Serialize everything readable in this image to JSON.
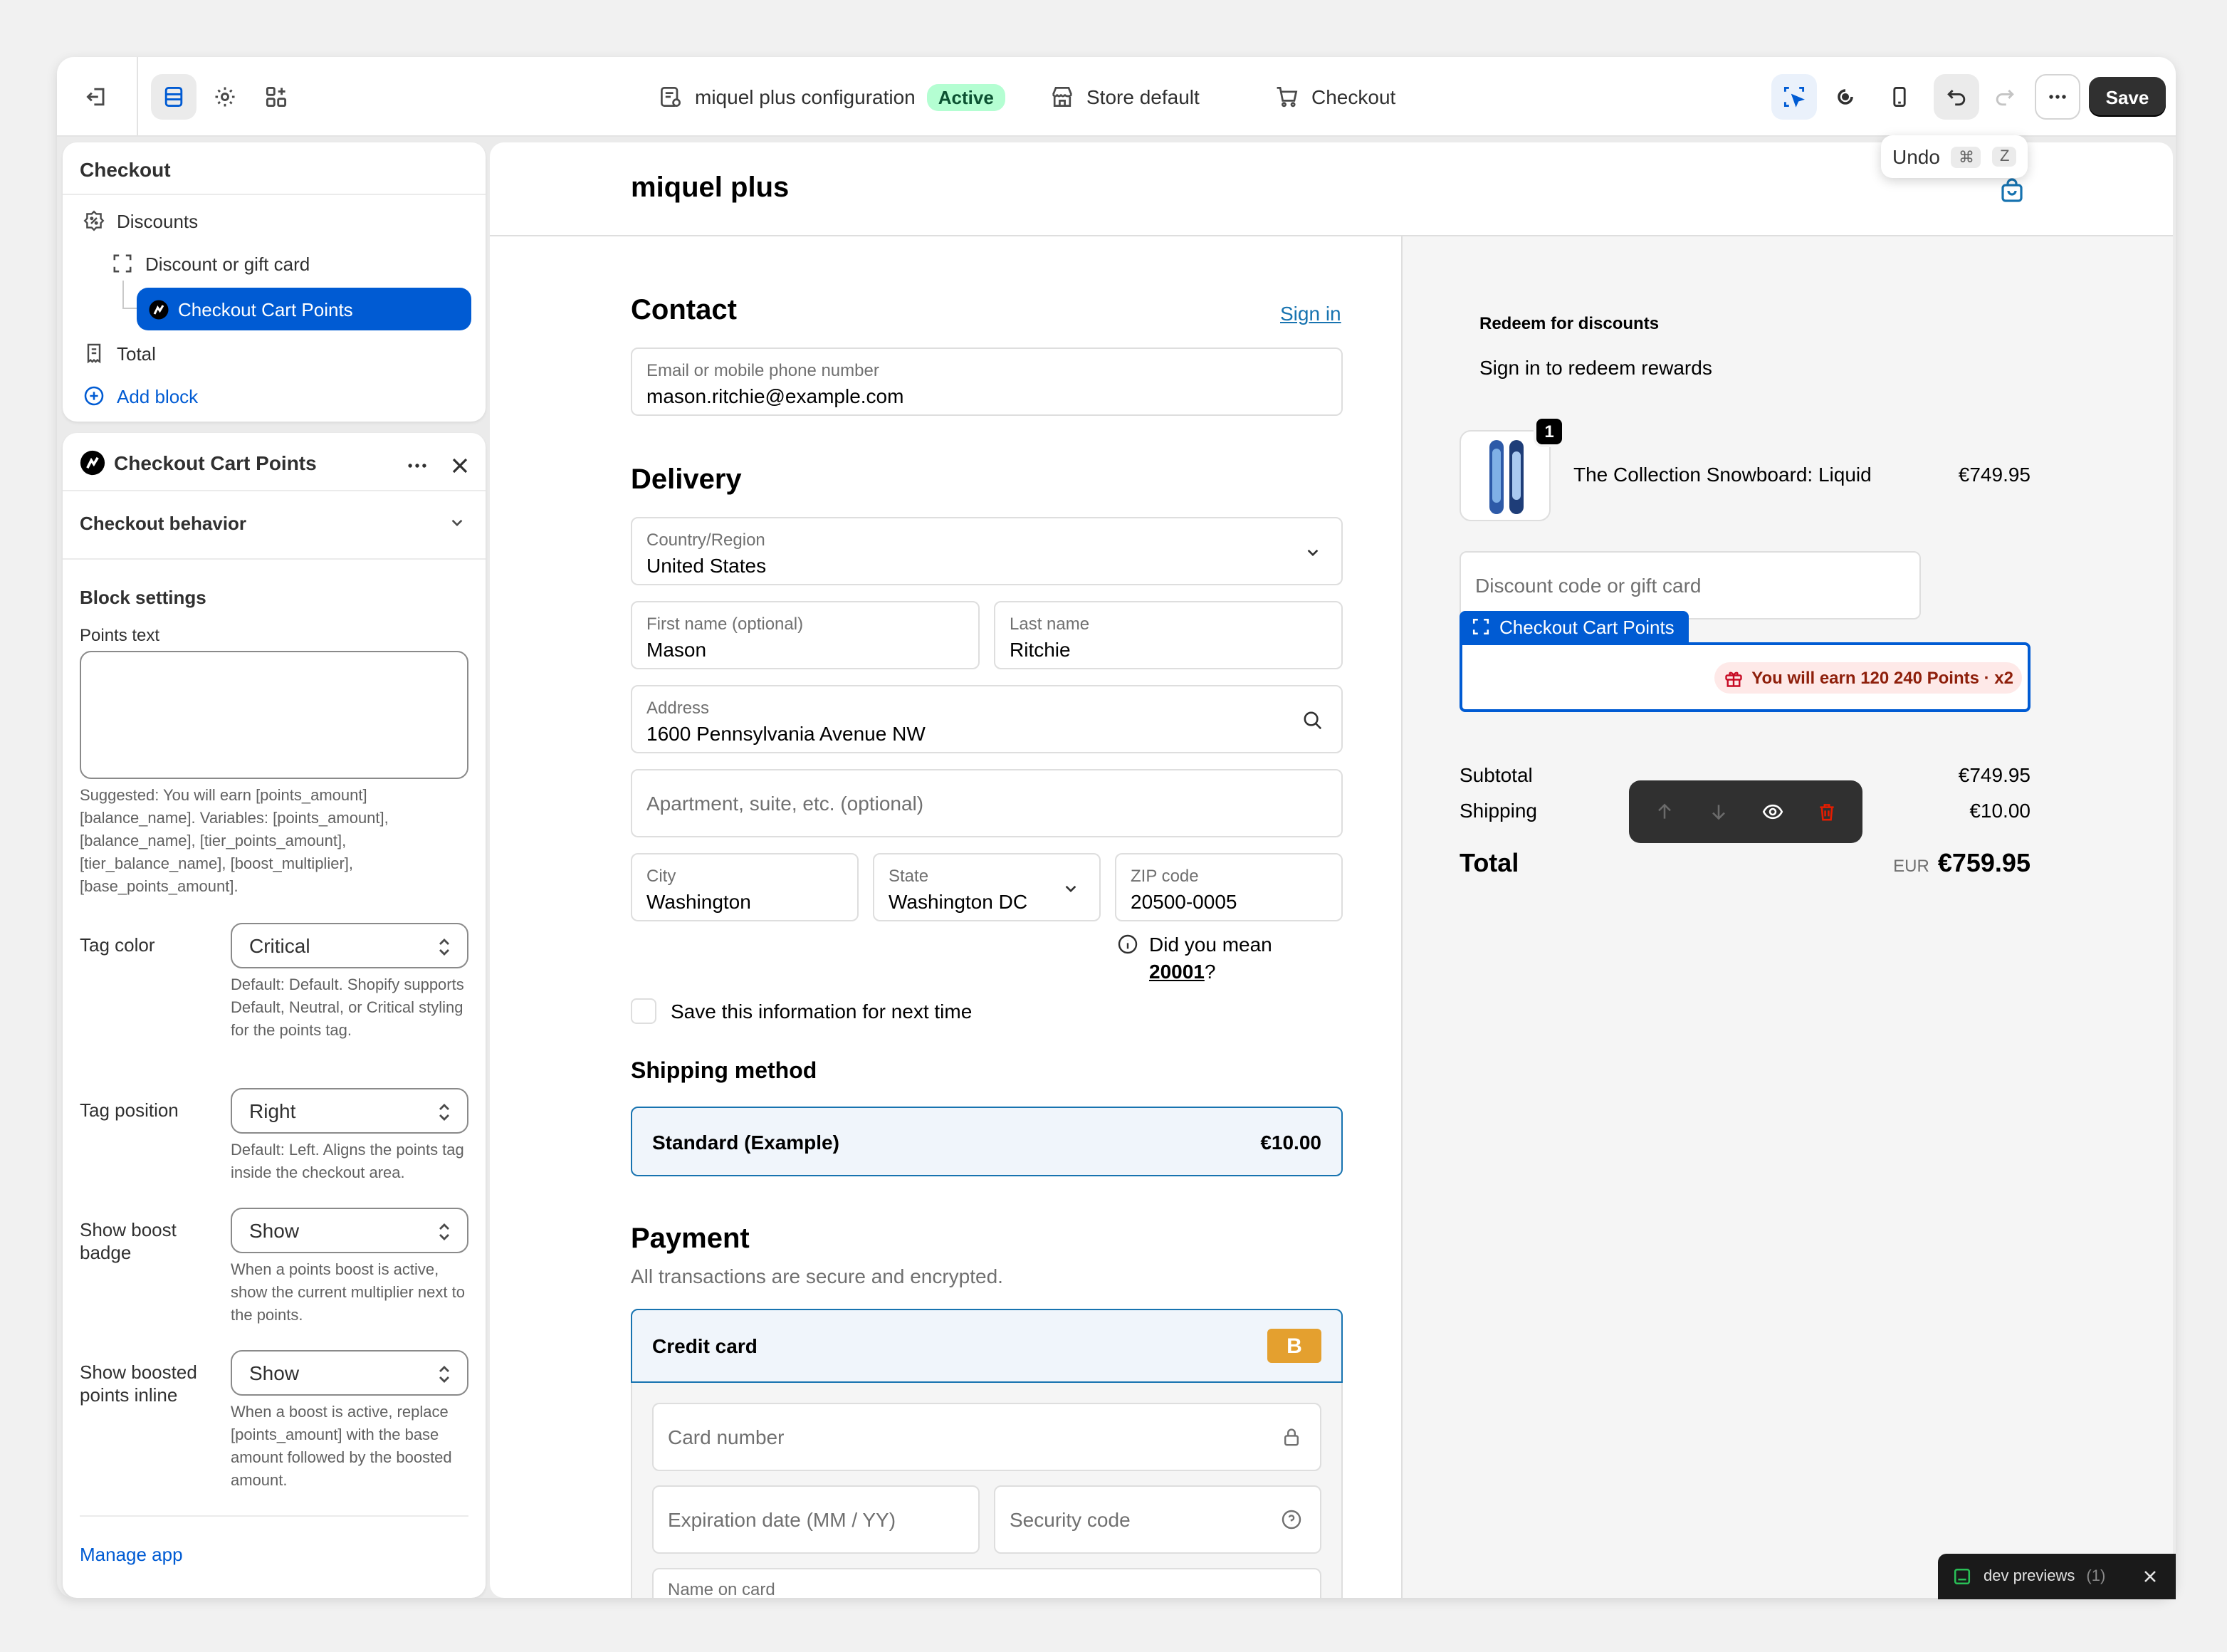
{
  "topbar": {
    "config_name": "miquel plus configuration",
    "status_badge": "Active",
    "store": "Store default",
    "page": "Checkout",
    "save_label": "Save",
    "undo_tooltip": {
      "label": "Undo",
      "key1": "⌘",
      "key2": "Z"
    }
  },
  "sidebar": {
    "section_title": "Checkout",
    "items": [
      {
        "label": "Discounts",
        "icon": "discount-gear-icon"
      },
      {
        "label": "Discount or gift card",
        "icon": "dashed-frame-icon"
      },
      {
        "label": "Checkout Cart Points",
        "icon": "app-logo-icon",
        "selected": true
      },
      {
        "label": "Total",
        "icon": "receipt-icon"
      }
    ],
    "add_block": "Add block"
  },
  "block_panel": {
    "title": "Checkout Cart Points",
    "accordion": "Checkout behavior",
    "settings_heading": "Block settings",
    "points_text_label": "Points text",
    "points_text_value": "",
    "points_text_help": "Suggested: You will earn [points_amount] [balance_name]. Variables: [points_amount], [balance_name], [tier_points_amount], [tier_balance_name], [boost_multiplier], [base_points_amount].",
    "fields": [
      {
        "label": "Tag color",
        "value": "Critical",
        "help": "Default: Default. Shopify supports Default, Neutral, or Critical styling for the points tag."
      },
      {
        "label": "Tag position",
        "value": "Right",
        "help": "Default: Left. Aligns the points tag inside the checkout area."
      },
      {
        "label": "Show boost badge",
        "value": "Show",
        "help": "When a points boost is active, show the current multiplier next to the points."
      },
      {
        "label": "Show boosted points inline",
        "value": "Show",
        "help": "When a boost is active, replace [points_amount] with the base amount followed by the boosted amount."
      }
    ],
    "manage_app": "Manage app"
  },
  "checkout": {
    "shop_name": "miquel plus",
    "contact_heading": "Contact",
    "sign_in": "Sign in",
    "email_label": "Email or mobile phone number",
    "email_value": "mason.ritchie@example.com",
    "delivery_heading": "Delivery",
    "country_label": "Country/Region",
    "country_value": "United States",
    "first_name_label": "First name (optional)",
    "first_name_value": "Mason",
    "last_name_label": "Last name",
    "last_name_value": "Ritchie",
    "address_label": "Address",
    "address_value": "1600 Pennsylvania Avenue NW",
    "apartment_placeholder": "Apartment, suite, etc. (optional)",
    "city_label": "City",
    "city_value": "Washington",
    "state_label": "State",
    "state_value": "Washington DC",
    "zip_label": "ZIP code",
    "zip_value": "20500-0005",
    "zip_suggestion_prefix": "Did you mean",
    "zip_suggestion_value": "20001",
    "zip_suggestion_suffix": "?",
    "save_info": "Save this information for next time",
    "shipping_heading": "Shipping method",
    "shipping_option": "Standard (Example)",
    "shipping_price": "€10.00",
    "payment_heading": "Payment",
    "payment_sub": "All transactions are secure and encrypted.",
    "credit_card": "Credit card",
    "card_brand": "B",
    "card_number": "Card number",
    "expiration": "Expiration date (MM / YY)",
    "security_code": "Security code",
    "name_on_card": "Name on card"
  },
  "summary": {
    "redeem_title": "Redeem for discounts",
    "redeem_sub": "Sign in to redeem rewards",
    "product_name": "The Collection Snowboard: Liquid",
    "product_price": "€749.95",
    "product_qty": "1",
    "discount_placeholder": "Discount code or gift card",
    "block_tag": "Checkout Cart Points",
    "points_tag": "You will earn 120 240 Points · x2",
    "subtotal_label": "Subtotal",
    "subtotal_value": "€749.95",
    "shipping_label": "Shipping",
    "shipping_value": "€10.00",
    "total_label": "Total",
    "total_currency": "EUR",
    "total_value": "€759.95"
  },
  "dev_bar": {
    "label": "dev previews",
    "count": "(1)"
  },
  "colors": {
    "accent": "#005bd3",
    "save": "#303030",
    "active_badge": "#b4fed2",
    "critical_tag": "#fee9e8"
  }
}
